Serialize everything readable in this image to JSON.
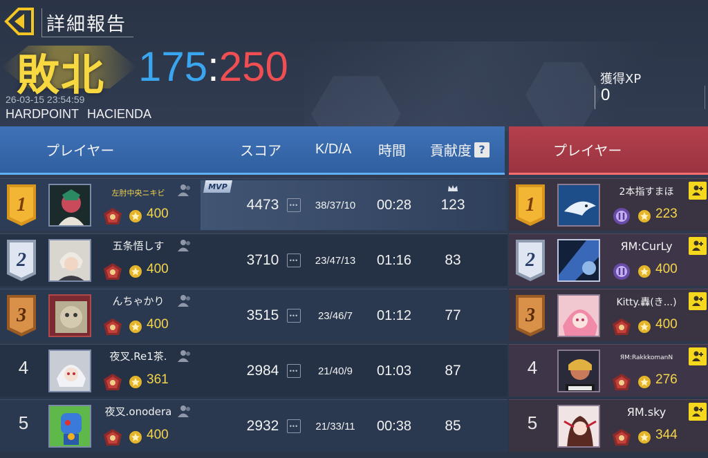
{
  "header": {
    "title": "詳細報告",
    "result": "敗北",
    "score_blue": "175",
    "score_separator": ":",
    "score_red": "250",
    "timestamp": "26-03-15 23:54:59",
    "mode": "HARDPOINT",
    "map": "HACIENDA",
    "xp_label": "獲得XP",
    "xp_value": "0"
  },
  "colors": {
    "blue_team": "#3ba6f0",
    "red_team": "#ef4e52",
    "result_gold": "#f7d840",
    "level_gold": "#f5d54a"
  },
  "columns": {
    "player": "プレイヤー",
    "score": "スコア",
    "kda": "K/D/A",
    "time": "時間",
    "contribution": "貢献度",
    "help": "?",
    "enemy_player": "プレイヤー"
  },
  "mvp_label": "MVP",
  "blue_team": [
    {
      "rank": "1",
      "name": "左肘中央ニキビ",
      "level": "400",
      "score": "4473",
      "kda": "38/37/10",
      "time": "00:28",
      "contribution": "123",
      "mvp": true
    },
    {
      "rank": "2",
      "name": "五条悟しす",
      "level": "400",
      "score": "3710",
      "kda": "23/47/13",
      "time": "01:16",
      "contribution": "83"
    },
    {
      "rank": "3",
      "name": "んちゃかり",
      "level": "400",
      "score": "3515",
      "kda": "23/46/7",
      "time": "01:12",
      "contribution": "77"
    },
    {
      "rank": "4",
      "name": "夜叉.Re1茶.",
      "level": "361",
      "score": "2984",
      "kda": "21/40/9",
      "time": "01:03",
      "contribution": "87"
    },
    {
      "rank": "5",
      "name": "夜叉.onodera",
      "level": "400",
      "score": "2932",
      "kda": "21/33/11",
      "time": "00:38",
      "contribution": "85"
    }
  ],
  "red_team": [
    {
      "rank": "1",
      "name": "2本指すまほ",
      "level": "223"
    },
    {
      "rank": "2",
      "name": "ЯM:CurLy",
      "level": "400"
    },
    {
      "rank": "3",
      "name": "Kitty.轟(き...)",
      "level": "400"
    },
    {
      "rank": "4",
      "name": "ЯM:RakkkomanN",
      "level": "276"
    },
    {
      "rank": "5",
      "name": "ЯM.sky",
      "level": "344"
    }
  ]
}
